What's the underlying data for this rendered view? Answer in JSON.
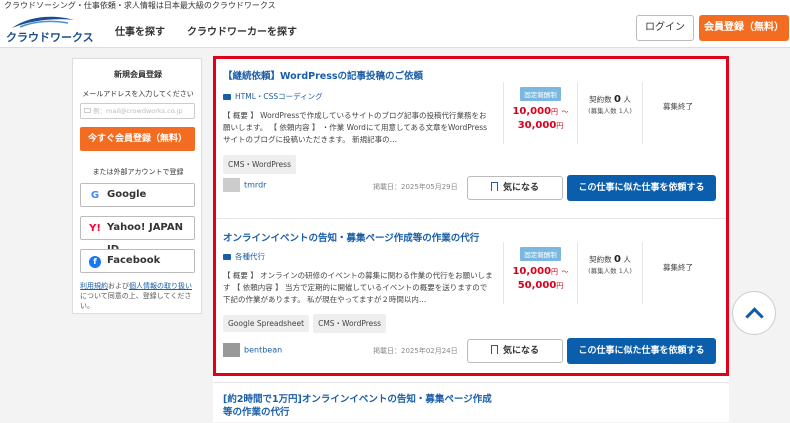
{
  "topbar": {
    "tagline": "クラウドソーシング・仕事依頼・求人情報は日本最大級のクラウドワークス"
  },
  "header": {
    "logo_text": "クラウドワークス",
    "nav": [
      "仕事を探す",
      "クラウドワーカーを探す"
    ],
    "login_label": "ログイン",
    "register_label": "会員登録（無料）"
  },
  "sidebar": {
    "title": "新規会員登録",
    "email_prompt": "メールアドレスを入力してください",
    "email_placeholder": "例：mail@crowdworks.co.jp",
    "register_label": "今すぐ会員登録（無料）",
    "external_label": "または外部アカウントで登録",
    "sso": [
      {
        "label": "Google",
        "icon": "google-icon"
      },
      {
        "label": "Yahoo! JAPAN ID",
        "icon": "yahoo-icon"
      },
      {
        "label": "Facebook",
        "icon": "facebook-icon"
      }
    ],
    "terms": {
      "link1": "利用規約",
      "mid": "および",
      "link2": "個人情報の取り扱い",
      "rest": "について同意の上、登録してください。"
    }
  },
  "jobs": [
    {
      "title": "【継続依頼】WordPressの記事投稿のご依頼",
      "category": "HTML・CSSコーディング",
      "description": "【 概要 】 WordPressで作成しているサイトのブログ記事の投稿代行業務をお願いします。 【 依頼内容 】 ・作業 Wordにて用意してある文章をWordPressサイトのブログに投稿いただきます。 新規記事の…",
      "tags": [
        "CMS・WordPress"
      ],
      "user": "tmrdr",
      "posted_label": "掲載日：",
      "posted_date": "2025年05月29日",
      "fav_label": "気になる",
      "similar_label": "この仕事に似た仕事を依頼する",
      "badge": "固定報酬制",
      "price_min": "10,000",
      "price_max": "30,000",
      "yen": "円",
      "tilde": "〜",
      "contract_label": "契約数",
      "contract_count": "0",
      "contract_unit": "人",
      "contract_sub": "(募集人数 1人)",
      "status": "募集終了"
    },
    {
      "title": "オンラインイベントの告知・募集ページ作成等の作業の代行",
      "category": "各種代行",
      "description": "【 概要 】 オンラインの研修のイベントの募集に関わる作業の代行をお願いします 【 依頼内容 】 当方で定期的に開催しているイベントの概要を送りますので下記の作業があります。 私が現在やってますが２時間以内…",
      "tags": [
        "Google Spreadsheet",
        "CMS・WordPress"
      ],
      "user": "bentbean",
      "posted_label": "掲載日：",
      "posted_date": "2025年02月24日",
      "fav_label": "気になる",
      "similar_label": "この仕事に似た仕事を依頼する",
      "badge": "固定報酬制",
      "price_min": "10,000",
      "price_max": "50,000",
      "yen": "円",
      "tilde": "〜",
      "contract_label": "契約数",
      "contract_count": "0",
      "contract_unit": "人",
      "contract_sub": "(募集人数 1人)",
      "status": "募集終了"
    },
    {
      "title": "[約2時間で1万円]オンラインイベントの告知・募集ページ作成等の作業の代行"
    }
  ],
  "colors": {
    "brand_orange": "#f26d21",
    "link_blue": "#1a5ea8",
    "button_blue": "#0a5eab",
    "price_red": "#d9001b",
    "highlight_red": "#e0001b"
  }
}
